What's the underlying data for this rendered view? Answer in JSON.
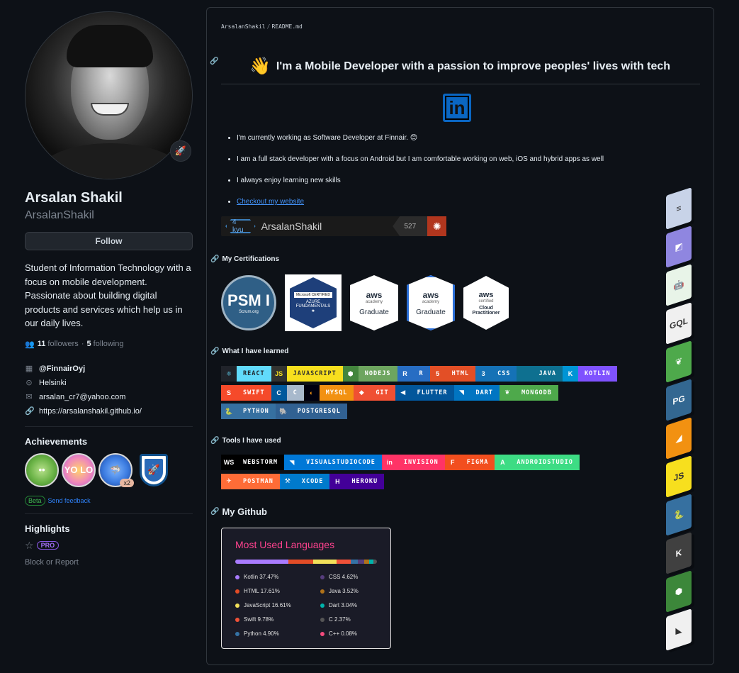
{
  "profile": {
    "name": "Arsalan Shakil",
    "login": "ArsalanShakil",
    "follow_label": "Follow",
    "bio": "Student of Information Technology with a focus on mobile development. Passionate about building digital products and services which help us in our daily lives.",
    "followers_count": "11",
    "followers_label": "followers",
    "following_count": "5",
    "following_label": "following",
    "separator": "·",
    "org": "@FinnairOyj",
    "location": "Helsinki",
    "email": "arsalan_cr7@yahoo.com",
    "website": "https://arsalanshakil.github.io/",
    "achievements_heading": "Achievements",
    "achievement_multiplier": "x2",
    "beta_label": "Beta",
    "feedback_label": "Send feedback",
    "highlights_heading": "Highlights",
    "pro_label": "PRO",
    "block_label": "Block or Report"
  },
  "readme": {
    "breadcrumb_user": "ArsalanShakil",
    "breadcrumb_sep": "/",
    "breadcrumb_file": "README.md",
    "heading": "I'm a Mobile Developer with a passion to improve peoples' lives with tech",
    "bullets": [
      "I'm currently working as Software Developer at Finnair. 😊",
      "I am a full stack developer with a focus on Android but I am comfortable working on web, iOS and hybrid apps as well",
      "I always enjoy learning new skills"
    ],
    "website_link": "Checkout my website",
    "codewars": {
      "kyu": "4 kyu",
      "user": "ArsalanShakil",
      "score": "527"
    },
    "certifications_heading": "My Certifications",
    "certs": {
      "psm": "PSM I",
      "psm_sub": "Scrum.org",
      "azure_ms": "Microsoft CERTIFIED",
      "azure_text": "AZURE FUNDAMENTALS",
      "aws1_logo": "aws",
      "aws1_sub": "academy",
      "aws1_label": "Graduate",
      "aws2_logo": "aws",
      "aws2_sub": "academy",
      "aws2_label": "Graduate",
      "aws3_logo": "aws",
      "aws3_sub": "certified",
      "aws3_label": "Cloud Practitioner"
    },
    "learned_heading": "What I have learned",
    "tools_heading": "Tools I have used",
    "github_heading": "My Github"
  },
  "learned": [
    [
      {
        "icon": "⚛",
        "label": "REACT",
        "bg": "#61dafb",
        "fg": "#20232a",
        "ibg": "#20232a",
        "ifg": "#61dafb"
      },
      {
        "icon": "JS",
        "label": "JAVASCRIPT",
        "bg": "#f7df1e",
        "fg": "#323330",
        "ibg": "#323330",
        "ifg": "#f7df1e"
      },
      {
        "icon": "⬢",
        "label": "NODEJS",
        "bg": "#6da55f",
        "fg": "#ffffff",
        "ibg": "#43853d",
        "ifg": "#ffffff"
      },
      {
        "icon": "R",
        "label": "R",
        "bg": "#276dc3",
        "fg": "#ffffff",
        "ibg": "#276dc3",
        "ifg": "#ffffff"
      },
      {
        "icon": "5",
        "label": "HTML",
        "bg": "#e34f26",
        "fg": "#ffffff",
        "ibg": "#e34f26",
        "ifg": "#ffffff"
      },
      {
        "icon": "3",
        "label": "CSS",
        "bg": "#1572b6",
        "fg": "#ffffff",
        "ibg": "#1572b6",
        "ifg": "#ffffff"
      },
      {
        "icon": "",
        "label": "JAVA",
        "bg": "#0e7090",
        "fg": "#ffffff",
        "ibg": "#0e7090",
        "ifg": "#ffffff"
      },
      {
        "icon": "K",
        "label": "KOTLIN",
        "bg": "#7f52ff",
        "fg": "#ffffff",
        "ibg": "#0095d5",
        "ifg": "#ffffff"
      }
    ],
    [
      {
        "icon": "S",
        "label": "SWIFT",
        "bg": "#f54a2a",
        "fg": "#ffffff",
        "ibg": "#f54a2a",
        "ifg": "#ffffff"
      },
      {
        "icon": "C",
        "label": "C",
        "bg": "#a8b9cc",
        "fg": "#ffffff",
        "ibg": "#00599c",
        "ifg": "#ffffff"
      },
      {
        "icon": "◐",
        "label": "MYSQL",
        "bg": "#f29111",
        "fg": "#ffffff",
        "ibg": "#00000f",
        "ifg": "#f29111"
      },
      {
        "icon": "◆",
        "label": "GIT",
        "bg": "#f05033",
        "fg": "#ffffff",
        "ibg": "#f05033",
        "ifg": "#ffffff"
      },
      {
        "icon": "◀",
        "label": "FLUTTER",
        "bg": "#02569b",
        "fg": "#ffffff",
        "ibg": "#02569b",
        "ifg": "#ffffff"
      },
      {
        "icon": "◥",
        "label": "DART",
        "bg": "#0175c2",
        "fg": "#ffffff",
        "ibg": "#0175c2",
        "ifg": "#ffffff"
      },
      {
        "icon": "❦",
        "label": "MONGODB",
        "bg": "#4ea94b",
        "fg": "#ffffff",
        "ibg": "#4ea94b",
        "ifg": "#ffffff"
      }
    ],
    [
      {
        "icon": "🐍",
        "label": "PYTHON",
        "bg": "#3670a0",
        "fg": "#ffffff",
        "ibg": "#3670a0",
        "ifg": "#ffdd54"
      },
      {
        "icon": "🐘",
        "label": "POSTGRESQL",
        "bg": "#316192",
        "fg": "#ffffff",
        "ibg": "#316192",
        "ifg": "#ffffff"
      }
    ]
  ],
  "tools": [
    [
      {
        "icon": "WS",
        "label": "WEBSTORM",
        "bg": "#000000",
        "fg": "#ffffff",
        "ibg": "#000000",
        "ifg": "#ffffff"
      },
      {
        "icon": "◥",
        "label": "VISUALSTUDIOCODE",
        "bg": "#0078d7",
        "fg": "#ffffff",
        "ibg": "#0078d7",
        "ifg": "#ffffff"
      },
      {
        "icon": "in",
        "label": "INVISION",
        "bg": "#ff3366",
        "fg": "#ffffff",
        "ibg": "#ff3366",
        "ifg": "#ffffff"
      },
      {
        "icon": "F",
        "label": "FIGMA",
        "bg": "#f24e1e",
        "fg": "#ffffff",
        "ibg": "#f24e1e",
        "ifg": "#ffffff"
      },
      {
        "icon": "A",
        "label": "ANDROIDSTUDIO",
        "bg": "#3ddc84",
        "fg": "#ffffff",
        "ibg": "#3ddc84",
        "ifg": "#ffffff"
      }
    ],
    [
      {
        "icon": "✈",
        "label": "POSTMAN",
        "bg": "#ff6c37",
        "fg": "#ffffff",
        "ibg": "#ff6c37",
        "ifg": "#ffffff"
      },
      {
        "icon": "⚒",
        "label": "XCODE",
        "bg": "#007acc",
        "fg": "#ffffff",
        "ibg": "#007acc",
        "ifg": "#ffffff"
      },
      {
        "icon": "H",
        "label": "HEROKU",
        "bg": "#430098",
        "fg": "#ffffff",
        "ibg": "#430098",
        "ifg": "#ffffff"
      }
    ]
  ],
  "languages": {
    "title": "Most Used Languages",
    "items": [
      {
        "name": "Kotlin",
        "pct": "37.47%",
        "value": 37.47,
        "color": "#a97bff"
      },
      {
        "name": "CSS",
        "pct": "4.62%",
        "value": 4.62,
        "color": "#563d7c"
      },
      {
        "name": "HTML",
        "pct": "17.61%",
        "value": 17.61,
        "color": "#e34c26"
      },
      {
        "name": "Java",
        "pct": "3.52%",
        "value": 3.52,
        "color": "#b07219"
      },
      {
        "name": "JavaScript",
        "pct": "16.61%",
        "value": 16.61,
        "color": "#f1e05a"
      },
      {
        "name": "Dart",
        "pct": "3.04%",
        "value": 3.04,
        "color": "#00b4ab"
      },
      {
        "name": "Swift",
        "pct": "9.78%",
        "value": 9.78,
        "color": "#f05138"
      },
      {
        "name": "C",
        "pct": "2.37%",
        "value": 2.37,
        "color": "#555555"
      },
      {
        "name": "Python",
        "pct": "4.90%",
        "value": 4.9,
        "color": "#3572a5"
      },
      {
        "name": "C++",
        "pct": "0.08%",
        "value": 0.08,
        "color": "#f34b7d"
      }
    ]
  },
  "cubes": [
    {
      "label": "≡",
      "color": "#c8d3e8"
    },
    {
      "label": "◩",
      "color": "#8f86e0"
    },
    {
      "label": "🤖",
      "color": "#e8f4e8"
    },
    {
      "label": "GQL",
      "color": "#f0f0f0"
    },
    {
      "label": "❦",
      "color": "#4ea94b"
    },
    {
      "label": "PG",
      "color": "#336791"
    },
    {
      "label": "◢",
      "color": "#f29111"
    },
    {
      "label": "JS",
      "color": "#f7df1e"
    },
    {
      "label": "🐍",
      "color": "#3670a0"
    },
    {
      "label": "K",
      "color": "#404040"
    },
    {
      "label": "⬢",
      "color": "#3c873a"
    },
    {
      "label": "◣",
      "color": "#f0f0f0"
    }
  ]
}
